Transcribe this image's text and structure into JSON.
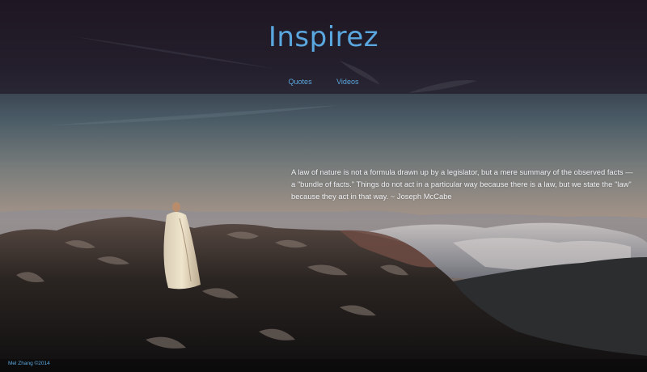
{
  "header": {
    "title": "Inspirez",
    "nav": [
      {
        "label": "Quotes"
      },
      {
        "label": "Videos"
      }
    ]
  },
  "main": {
    "quote": "A law of nature is not a formula drawn up by a legislator, but a mere summary of the observed facts — a \"bundle of facts.\" Things do not act in a particular way because there is a law, but we state the \"law\" because they act in that way. ~ Joseph McCabe"
  },
  "footer": {
    "copyright": "Mel Zhang ©2014"
  },
  "colors": {
    "accent": "#5aa7df",
    "quote_text": "#eef0f4"
  }
}
